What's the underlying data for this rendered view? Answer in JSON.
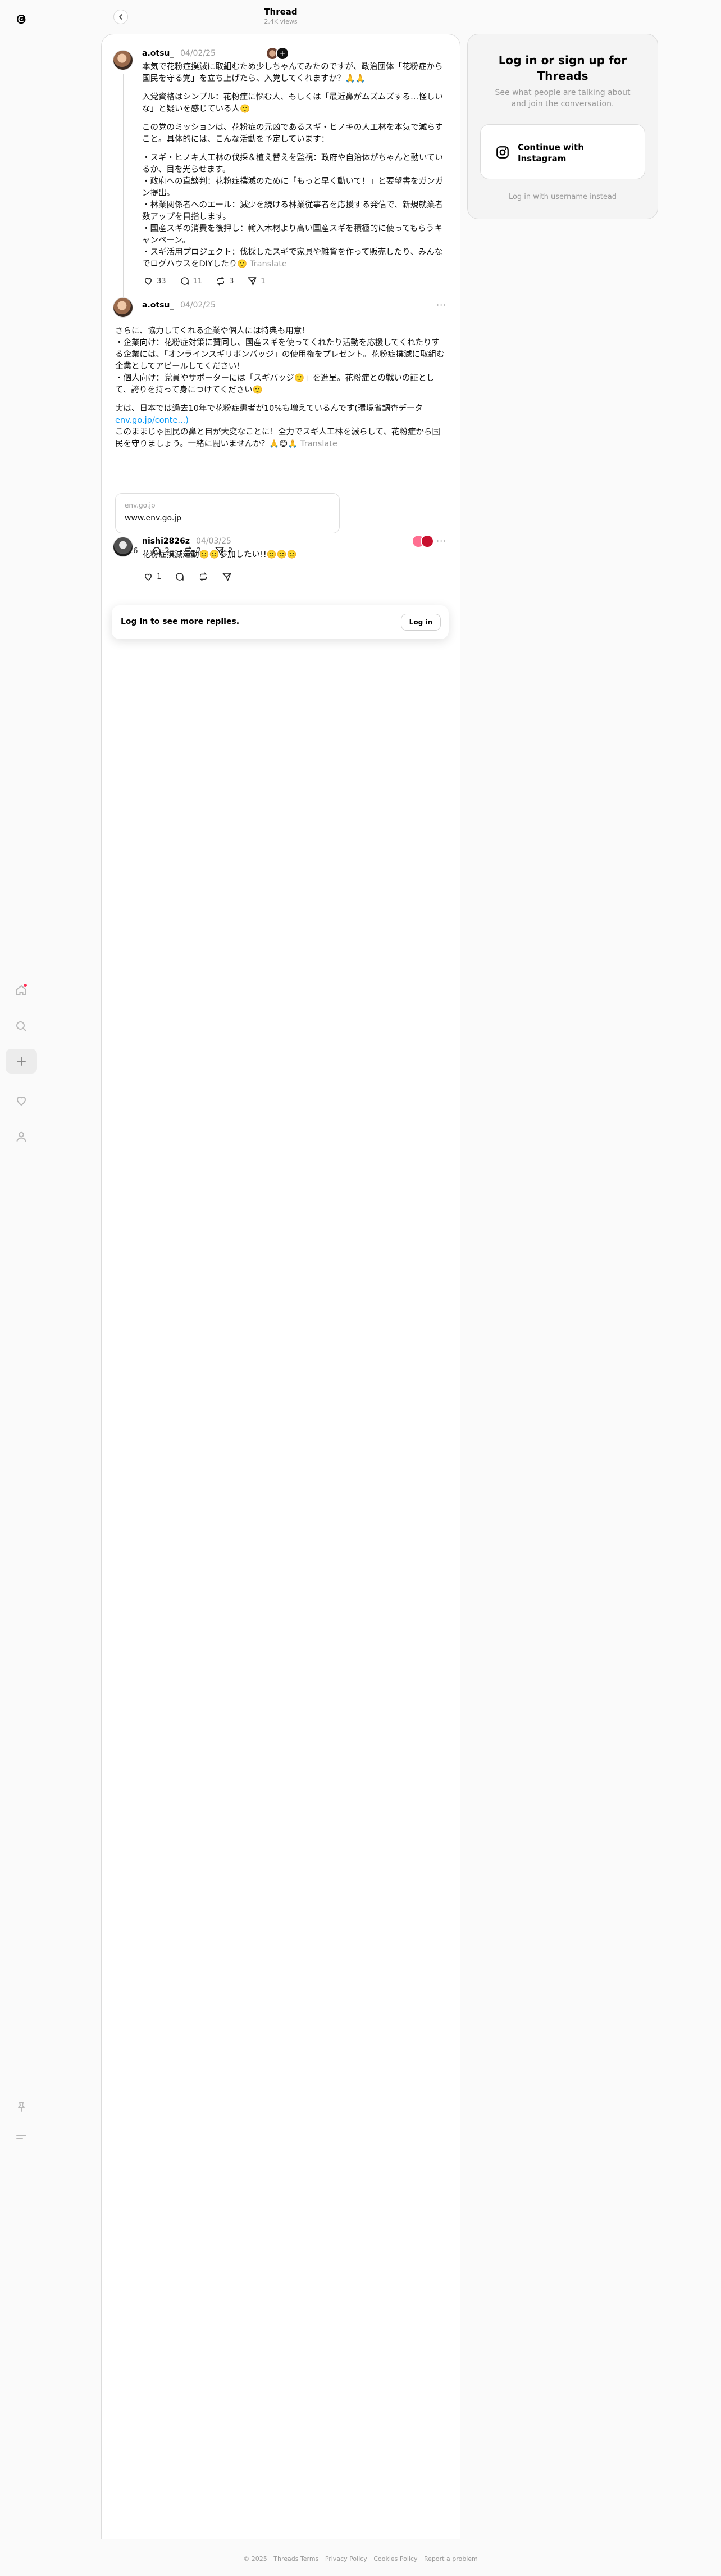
{
  "header": {
    "title": "Thread",
    "views": "2.4K views"
  },
  "nav": {
    "icons": [
      "threads-logo-icon",
      "home-icon",
      "search-icon",
      "create-icon",
      "heart-icon",
      "profile-icon",
      "pin-icon",
      "menu-icon"
    ]
  },
  "posts": [
    {
      "username": "a.otsu_",
      "date": "04/02/25",
      "paragraphs": [
        "本気で花粉症撲滅に取組むため少しちゃんてみたのですが、政治団体「花粉症から国民を守る党」を立ち上げたら、入党してくれますか？🙏🙏",
        "入党資格はシンプル：花粉症に悩む人、もしくは「最近鼻がムズムズする…怪しいな」と疑いを感じている人🙂",
        "この党のミッションは、花粉症の元凶であるスギ・ヒノキの人工林を本気で減らすこと。具体的には、こんな活動を予定しています：",
        "・スギ・ヒノキ人工林の伐採＆植え替えを監視：政府や自治体がちゃんと動いているか、目を光らせます。\n・政府への直談判：花粉症撲滅のために「もっと早く動いて！」と要望書をガンガン提出。\n・林業関係者へのエール：減少を続ける林業従事者を応援する発信で、新規就業者数アップを目指します。\n・国産スギの消費を後押し：輸入木材より高い国産スギを積極的に使ってもらうキャンペーン。\n・スギ活用プロジェクト：伐採したスギで家具や雑貨を作って販売したり、みんなでログハウスをDIYしたり🙂"
      ],
      "translate": "Translate",
      "likes": "33",
      "replies": "11",
      "reposts": "3",
      "shares": "1"
    },
    {
      "username": "a.otsu_",
      "date": "04/02/25",
      "more": "···",
      "paragraphs": [
        "さらに、協力してくれる企業や個人には特典も用意！\n・企業向け：花粉症対策に賛同し、国産スギを使ってくれたり活動を応援してくれたりする企業には、「オンラインスギリボンバッジ」の使用権をプレゼント。花粉症撲滅に取組む企業としてアピールしてください！\n・個人向け：党員やサポーターには「スギバッジ🙂」を進呈。花粉症との戦いの証として、誇りを持って身につけてください🙂"
      ],
      "p2_text": "実は、日本では過去10年で花粉症患者が10%も増えているんです(環境省調査データ",
      "p2_link": "env.go.jp/conte...)",
      "p3_text": "このままじゃ国民の鼻と目が大変なことに！全力でスギ人工林を減らして、花粉症から国民を守りましょう。一緒に闘いませんか？🙏😊🙏",
      "translate": "Translate",
      "link_card": {
        "domain": "env.go.jp",
        "url": "www.env.go.jp"
      },
      "likes": "26",
      "replies": "2",
      "reposts": "2",
      "shares": "2"
    },
    {
      "username": "nishi2826z",
      "date": "04/03/25",
      "more": "···",
      "text": "花粉症撲滅運動🙂🙂参加したい!!🙂🙂🙂",
      "likes": "1"
    }
  ],
  "login_bar": {
    "text": "Log in to see more replies.",
    "button": "Log in"
  },
  "login_card": {
    "title": "Log in or sign up for Threads",
    "subtitle": "See what people are talking about and join the conversation.",
    "instagram_button": "Continue with Instagram",
    "username_link": "Log in with username instead"
  },
  "footer": {
    "items": [
      "© 2025",
      "Threads Terms",
      "Privacy Policy",
      "Cookies Policy",
      "Report a problem"
    ]
  },
  "colors": {
    "link": "#0095f6",
    "accent_dot": "#ff2d55"
  }
}
